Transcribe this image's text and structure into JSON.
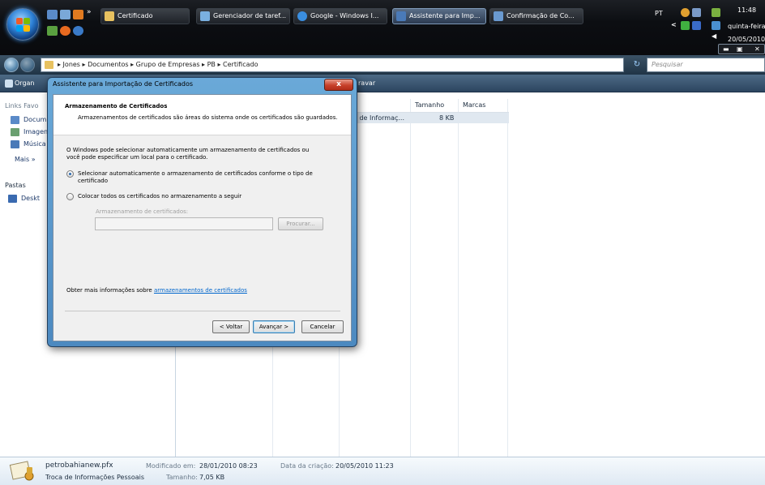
{
  "taskbar": {
    "tasks": [
      {
        "label": "Certificado",
        "color": "#e8c260"
      },
      {
        "label": "Gerenciador de taref...",
        "color": "#7ab0e0"
      },
      {
        "label": "Google - Windows I...",
        "color": "#3a8ee0"
      },
      {
        "label": "Assistente para Imp...",
        "color": "#4a7ab8"
      },
      {
        "label": "Confirmação de Co...",
        "color": "#6a9ad0"
      }
    ],
    "tray": {
      "language": "PT",
      "time": "11:48",
      "day": "quinta-feira",
      "date": "20/05/2010"
    }
  },
  "explorer": {
    "address": "▸ Jones ▸ Documentos ▸ Grupo de Empresas ▸ PB ▸ Certificado",
    "search_placeholder": "Pesquisar",
    "toolbar": {
      "organize": "Organ",
      "burn": "ravar"
    },
    "left_pane": {
      "favorites_header": "Links Favo",
      "favorites": [
        {
          "label": "Docum",
          "icon": "documents-icon",
          "color": "#5a8ac8"
        },
        {
          "label": "Imagen",
          "icon": "pictures-icon",
          "color": "#6aa070"
        },
        {
          "label": "Música",
          "icon": "music-icon",
          "color": "#4a7ab8"
        }
      ],
      "more": "Mais »",
      "folders_header": "Pastas",
      "folders": [
        {
          "label": "Deskt",
          "icon": "desktop-icon",
          "color": "#3a6ab0"
        }
      ]
    },
    "columns": [
      {
        "label": "Tamanho"
      },
      {
        "label": "Marcas"
      }
    ],
    "file": {
      "type": "a de Informaç...",
      "size": "8 KB"
    },
    "details": {
      "filename": "petrobahianew.pfx",
      "filetype": "Troca de Informações Pessoais",
      "modified_label": "Modificado em:",
      "modified_value": "28/01/2010 08:23",
      "created_label": "Data da criação:",
      "created_value": "20/05/2010 11:23",
      "size_label": "Tamanho:",
      "size_value": "7,05 KB"
    }
  },
  "dialog": {
    "title": "Assistente para Importação de Certificados",
    "close": "x",
    "heading": "Armazenamento de Certificados",
    "subheading": "Armazenamentos de certificados são áreas do sistema onde os certificados são guardados.",
    "intro_line1": "O Windows pode selecionar automaticamente um armazenamento de certificados ou",
    "intro_line2": "você pode especificar um local para o certificado.",
    "option_auto_line1": "Selecionar automaticamente o armazenamento de certificados conforme o tipo de",
    "option_auto_line2": "certificado",
    "option_manual": "Colocar todos os certificados no armazenamento a seguir",
    "store_label": "Armazenamento de certificados:",
    "browse": "Procurar...",
    "more_info_prefix": "Obter mais informações sobre ",
    "more_info_link": "armazenamentos de certificados",
    "back": "< Voltar",
    "next": "Avançar >",
    "cancel": "Cancelar"
  }
}
